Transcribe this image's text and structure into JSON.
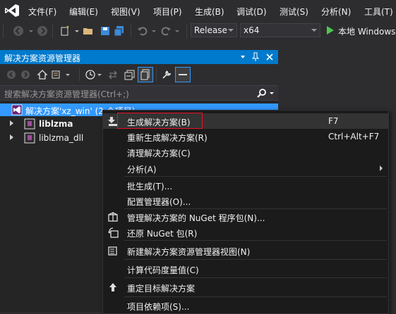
{
  "menubar": {
    "items": [
      "文件(F)",
      "编辑(E)",
      "视图(V)",
      "项目(P)",
      "生成(B)",
      "调试(D)",
      "测试(S)",
      "分析(N)",
      "工具(T)"
    ]
  },
  "toolbar": {
    "config": "Release",
    "platform": "x64",
    "start_label": "本地 Windows"
  },
  "solution_explorer": {
    "title": "解决方案资源管理器",
    "search_placeholder": "搜索解决方案资源管理器(Ctrl+;)",
    "solution_label": "解决方案'xz_win' (2 个项目)",
    "projects": [
      "liblzma",
      "liblzma_dll"
    ]
  },
  "context_menu": {
    "items": [
      {
        "label": "生成解决方案(B)",
        "shortcut": "F7"
      },
      {
        "label": "重新生成解决方案(R)",
        "shortcut": "Ctrl+Alt+F7"
      },
      {
        "label": "清理解决方案(C)",
        "shortcut": ""
      },
      {
        "label": "分析(A)",
        "shortcut": ""
      },
      {
        "label": "批生成(T)...",
        "shortcut": ""
      },
      {
        "label": "配置管理器(O)...",
        "shortcut": ""
      },
      {
        "label": "管理解决方案的 NuGet 程序包(N)...",
        "shortcut": ""
      },
      {
        "label": "还原 NuGet 包(R)",
        "shortcut": ""
      },
      {
        "label": "新建解决方案资源管理器视图(N)",
        "shortcut": ""
      },
      {
        "label": "计算代码度量值(C)",
        "shortcut": ""
      },
      {
        "label": "重定目标解决方案",
        "shortcut": ""
      },
      {
        "label": "项目依赖项(S)...",
        "shortcut": ""
      }
    ]
  },
  "colors": {
    "accent": "#007acc",
    "selection": "#3399ff",
    "highlight_border": "#e81123",
    "background": "#2d2d30"
  }
}
